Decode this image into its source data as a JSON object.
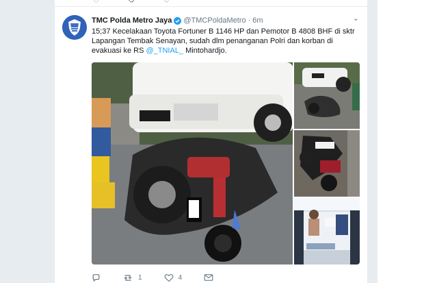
{
  "tweet": {
    "author": {
      "name": "TMC Polda Metro Jaya",
      "handle": "@TMCPoldaMetro",
      "separator": "·",
      "time": "6m"
    },
    "text": {
      "line1": "15;37 Kecelakaan Toyota Fortuner B 1146 HP dan Pemotor B 4808 BHF di sktr",
      "line2": "Lapangan Tembak Senayan, sudah dlm penanganan  Polri dan korban di",
      "line3_before": "evakuasi ke RS ",
      "mention": "@_TNIAL_",
      "line3_after": " Mintohardjo."
    },
    "counts": {
      "retweets": "1",
      "likes": "4"
    }
  },
  "icons": {
    "reply": "reply-icon",
    "retweet": "retweet-icon",
    "like": "heart-icon",
    "dm": "envelope-icon",
    "verified": "verified-badge-icon",
    "caret": "chevron-down-icon"
  },
  "colors": {
    "link": "#1da1f2",
    "muted": "#657786",
    "text": "#14171a",
    "background": "#e6ecf0"
  }
}
